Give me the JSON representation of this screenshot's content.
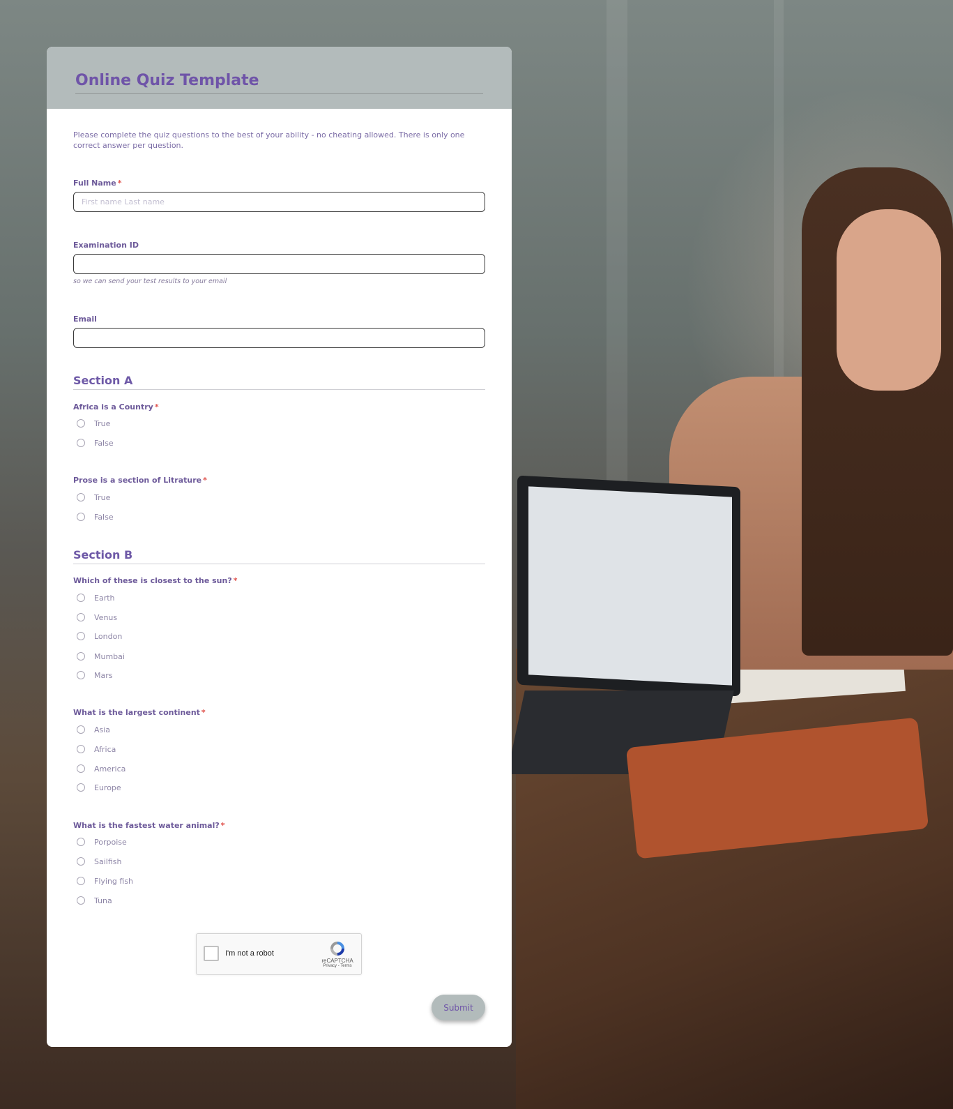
{
  "form": {
    "title": "Online Quiz Template",
    "intro": "Please complete the quiz questions to the best of your ability - no cheating allowed. There is only one correct answer per question.",
    "required_marker": "*",
    "fields": {
      "full_name": {
        "label": "Full Name",
        "placeholder": "First name Last name",
        "value": ""
      },
      "exam_id": {
        "label": "Examination ID",
        "value": "",
        "hint": "so we can send your test results to your email"
      },
      "email": {
        "label": "Email",
        "value": ""
      }
    },
    "sections": [
      {
        "title": "Section A",
        "questions": [
          {
            "text": "Africa is a Country",
            "options": [
              "True",
              "False"
            ]
          },
          {
            "text": "Prose is a section of Litrature",
            "options": [
              "True",
              "False"
            ]
          }
        ]
      },
      {
        "title": "Section B",
        "questions": [
          {
            "text": "Which of these is closest to the sun?",
            "options": [
              "Earth",
              "Venus",
              "London",
              "Mumbai",
              "Mars"
            ]
          },
          {
            "text": "What is the largest continent",
            "options": [
              "Asia",
              "Africa",
              "America",
              "Europe"
            ]
          },
          {
            "text": "What is the fastest water animal?",
            "options": [
              "Porpoise",
              "Sailfish",
              "Flying fish",
              "Tuna"
            ]
          }
        ]
      }
    ],
    "captcha": {
      "label": "I'm not a robot",
      "brand": "reCAPTCHA",
      "links": "Privacy - Terms"
    },
    "submit_label": "Submit"
  },
  "colors": {
    "accent": "#6f54a8",
    "header_bg": "#b3bbbb",
    "required": "#e0534d"
  }
}
